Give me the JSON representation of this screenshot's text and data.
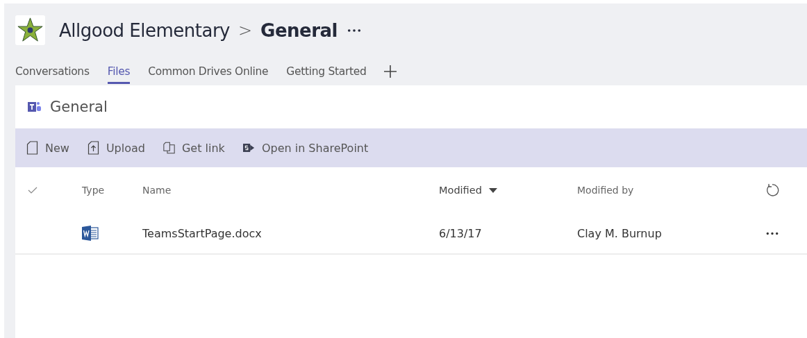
{
  "header": {
    "team": "Allgood Elementary",
    "separator": ">",
    "channel": "General"
  },
  "tabs": [
    {
      "label": "Conversations",
      "selected": false
    },
    {
      "label": "Files",
      "selected": true
    },
    {
      "label": "Common Drives Online",
      "selected": false
    },
    {
      "label": "Getting Started",
      "selected": false
    }
  ],
  "panel": {
    "title": "General"
  },
  "toolbar": [
    {
      "kind": "new",
      "label": "New"
    },
    {
      "kind": "upload",
      "label": "Upload"
    },
    {
      "kind": "link",
      "label": "Get link"
    },
    {
      "kind": "sharepoint",
      "label": "Open in SharePoint"
    }
  ],
  "table": {
    "columns": [
      "Type",
      "Name",
      "Modified",
      "Modified by"
    ],
    "rows": [
      {
        "kind": "word",
        "name": "TeamsStartPage.docx",
        "modified": "6/13/17",
        "modified_by": "Clay M. Burnup"
      }
    ]
  }
}
